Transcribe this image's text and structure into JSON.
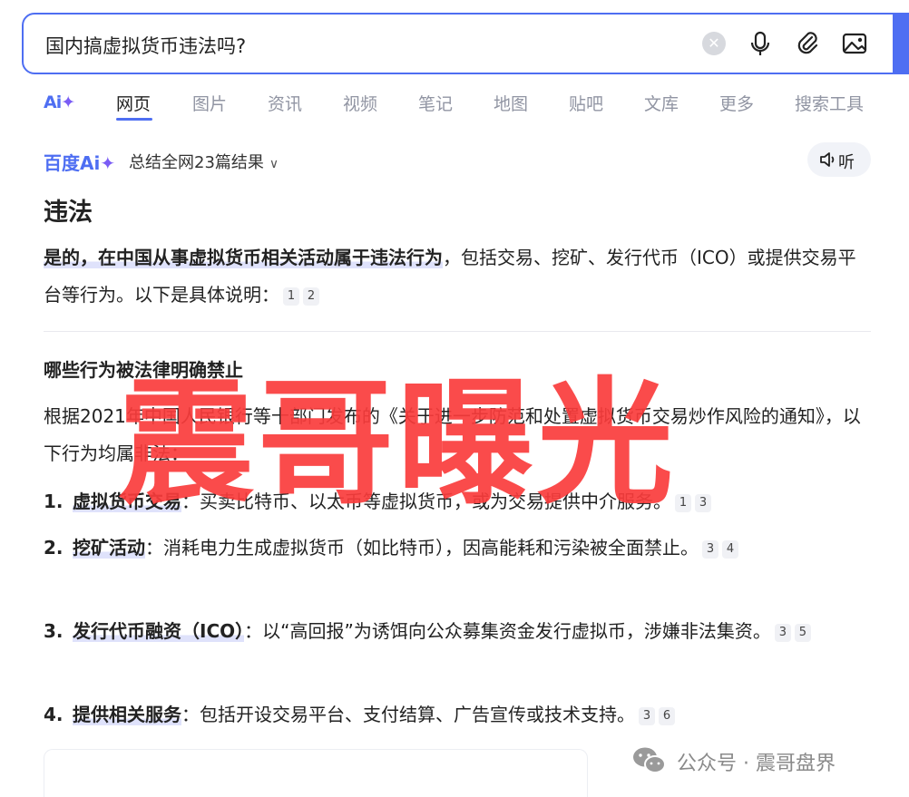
{
  "search": {
    "query": "国内搞虚拟货币违法吗?",
    "clear_icon": "close-circle-icon",
    "tools": [
      "microphone-icon",
      "paperclip-icon",
      "image-icon"
    ],
    "accent_color": "#4e6ef2"
  },
  "tabs": {
    "ai_label": "Ai",
    "items": [
      "网页",
      "图片",
      "资讯",
      "视频",
      "笔记",
      "地图",
      "贴吧",
      "文库",
      "更多",
      "搜索工具"
    ],
    "active": "网页"
  },
  "ai_header": {
    "brand": "百度Ai",
    "summary": "总结全网23篇结果",
    "listen_label": "听"
  },
  "answer": {
    "title": "违法",
    "intro_bold": "是的，在中国从事虚拟货币相关活动属于违法行为",
    "intro_rest": "，包括交易、挖矿、发行代币（ICO）或提供交易平台等行为。以下是具体说明：",
    "intro_cites": [
      "1",
      "2"
    ],
    "section_title": "哪些行为被法律明确禁止",
    "section_intro_1": "根据2021年中国人民银行等十部门发布的",
    "section_doc": "《关于进一步防范和处置虚拟货币交易炒作风险的通知》",
    "section_intro_2": "，以下行为均属非法：",
    "items": [
      {
        "num": "1.",
        "term": "虚拟货币交易",
        "text": "：买卖比特币、以太币等虚拟货币，或为交易提供中介服务。",
        "cites": [
          "1",
          "3"
        ]
      },
      {
        "num": "2.",
        "term": "挖矿活动",
        "text": "：消耗电力生成虚拟货币（如比特币），因高能耗和污染被全面禁止。",
        "cites": [
          "3",
          "4"
        ]
      },
      {
        "num": "3.",
        "term": "发行代币融资（ICO）",
        "text": "：以“高回报”为诱饵向公众募集资金发行虚拟币，涉嫌非法集资。",
        "cites": [
          "3",
          "5"
        ]
      },
      {
        "num": "4.",
        "term": "提供相关服务",
        "text": "：包括开设交易平台、支付结算、广告宣传或技术支持。",
        "cites": [
          "3",
          "6"
        ]
      }
    ]
  },
  "overlay": {
    "watermark_text": "震哥曝光",
    "watermark_color": "#fa3c3c",
    "account_icon": "wechat-icon",
    "account_text": "公众号 · 震哥盘界"
  }
}
